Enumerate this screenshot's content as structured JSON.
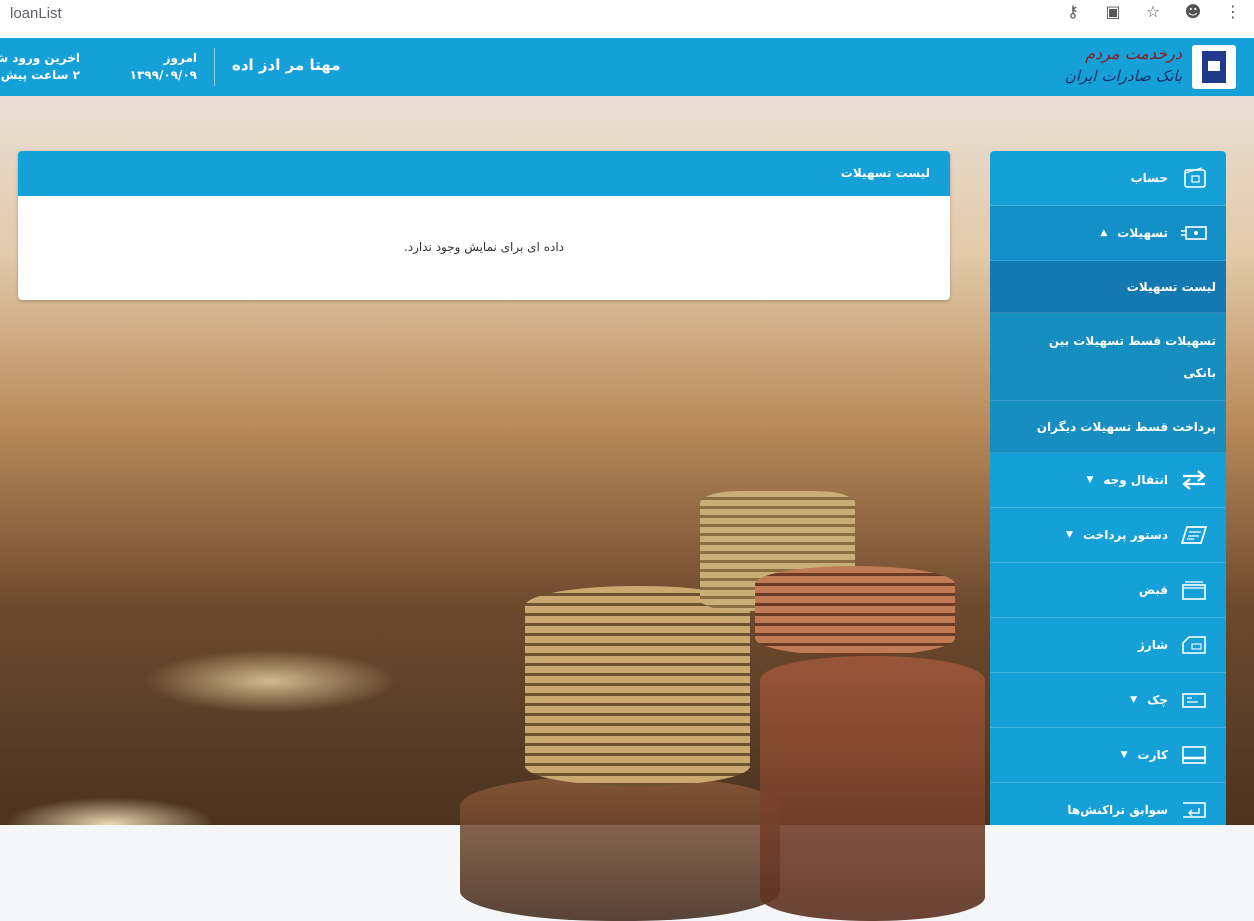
{
  "browser": {
    "tab_title": "loanList",
    "icons": [
      "key-icon",
      "image-blocked-icon",
      "star-icon",
      "profile-icon",
      "more-vert-icon"
    ]
  },
  "header": {
    "bank_name_line1": "درخدمت مردم",
    "bank_name_line2": "بانک صادرات ایران",
    "user_name": "مهتا مر ادز اده",
    "today_label": "امروز",
    "today_date": "۱۳۹۹/۰۹/۰۹",
    "last_login_label": "اخرین ورود ش",
    "last_login_value": "۲ ساعت پیش"
  },
  "panel": {
    "title": "لیست تسهیلات",
    "empty_message": "داده ای برای نمایش وجود ندارد."
  },
  "sidebar": {
    "account": "حساب",
    "facilities": "تسهیلات",
    "sub": {
      "loan_list": "لیست تسهیلات",
      "interbank_line1": "تسهیلات قسط تسهیلات بین",
      "interbank_line2": "بانکی",
      "pay_others": "پرداخت قسط تسهیلات دیگران"
    },
    "transfer": "انتقال وجه",
    "payment_order": "دستور پرداخت",
    "bill": "قبض",
    "charge": "شارژ",
    "cheque": "چک",
    "card": "کارت",
    "history": "سوابق تراکنش‌ها"
  },
  "colors": {
    "primary": "#16a0d8",
    "active": "#1479b0"
  }
}
